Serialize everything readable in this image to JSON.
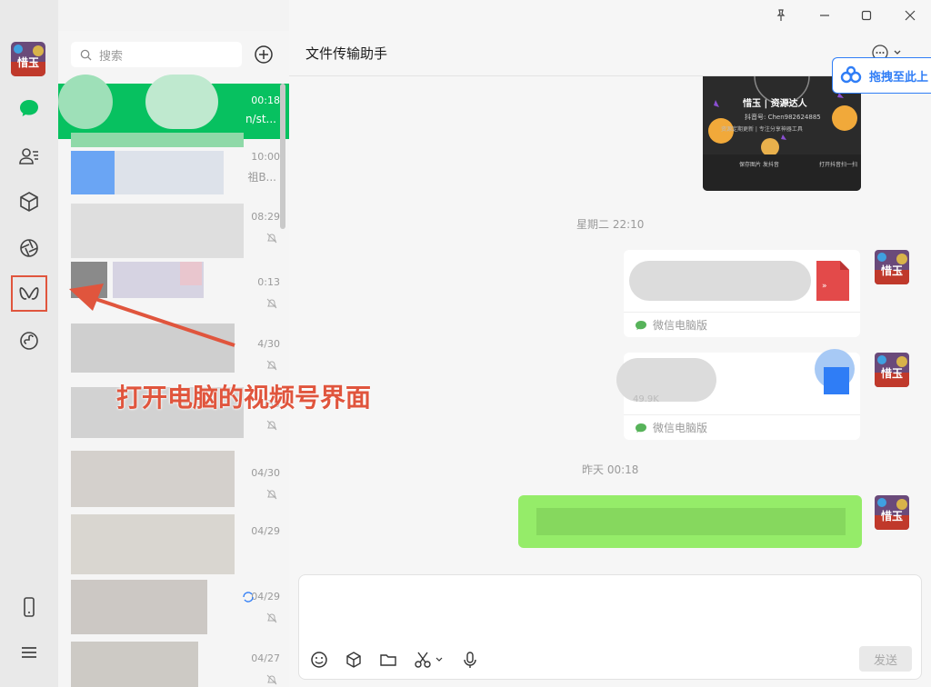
{
  "list": {
    "search_placeholder": "搜索",
    "items": [
      {
        "time": "00:18",
        "sub": "n/st..."
      },
      {
        "time": "10:00",
        "sub": "祖B..."
      },
      {
        "time": "08:29",
        "sub": ""
      },
      {
        "time": "0:13",
        "sub": ""
      },
      {
        "time": "4/30",
        "sub": ""
      },
      {
        "time": "4/30",
        "sub": ""
      },
      {
        "time": "04/30",
        "sub": ""
      },
      {
        "time": "04/29",
        "sub": ""
      },
      {
        "time": "04/29",
        "sub": ""
      },
      {
        "time": "04/27",
        "sub": ""
      }
    ]
  },
  "chat": {
    "title": "文件传输助手",
    "baidu_label": "拖拽至此上",
    "card": {
      "name": "惜玉 | 资源达人",
      "id_line": "抖音号: Chen982624885",
      "desc_line": "资源定期更新 | 专注分享神器工具",
      "left_caption": "保存图片 发抖音",
      "right_caption": "打开抖音扫一扫"
    },
    "stamps": {
      "s1": "星期二 22:10",
      "s2": "昨天 00:18"
    },
    "file_source": "微信电脑版",
    "file2_line": "49.9K",
    "send_label": "发送"
  },
  "avatar_text": "惜玉",
  "annotation": {
    "text": "打开电脑的视频号界面"
  },
  "colors": {
    "wechat_green": "#07c160",
    "bubble_green": "#95ec69",
    "annot_red": "#e0553d",
    "baidu_blue": "#2f7df6"
  }
}
